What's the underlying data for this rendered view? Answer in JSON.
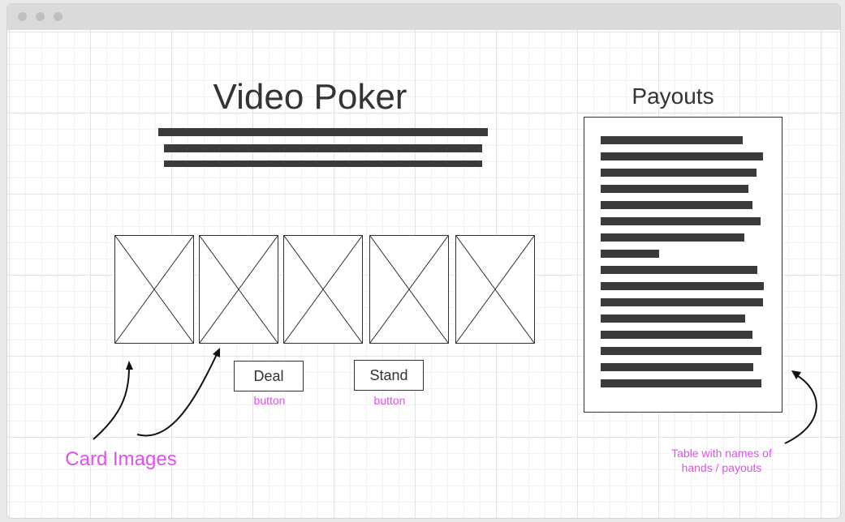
{
  "app": {
    "title": "Video Poker"
  },
  "payouts": {
    "title": "Payouts",
    "rows": 16
  },
  "cards": {
    "count": 5,
    "placeholder_icon": "image-placeholder-icon"
  },
  "buttons": {
    "deal_label": "Deal",
    "stand_label": "Stand",
    "type_label": "button"
  },
  "annotations": {
    "card_images": "Card Images",
    "table_note_line1": "Table with names of",
    "table_note_line2": "hands / payouts"
  },
  "colors": {
    "annotation": "#e14ff0",
    "text_placeholder": "#3b3b3b",
    "outline": "#333333"
  }
}
